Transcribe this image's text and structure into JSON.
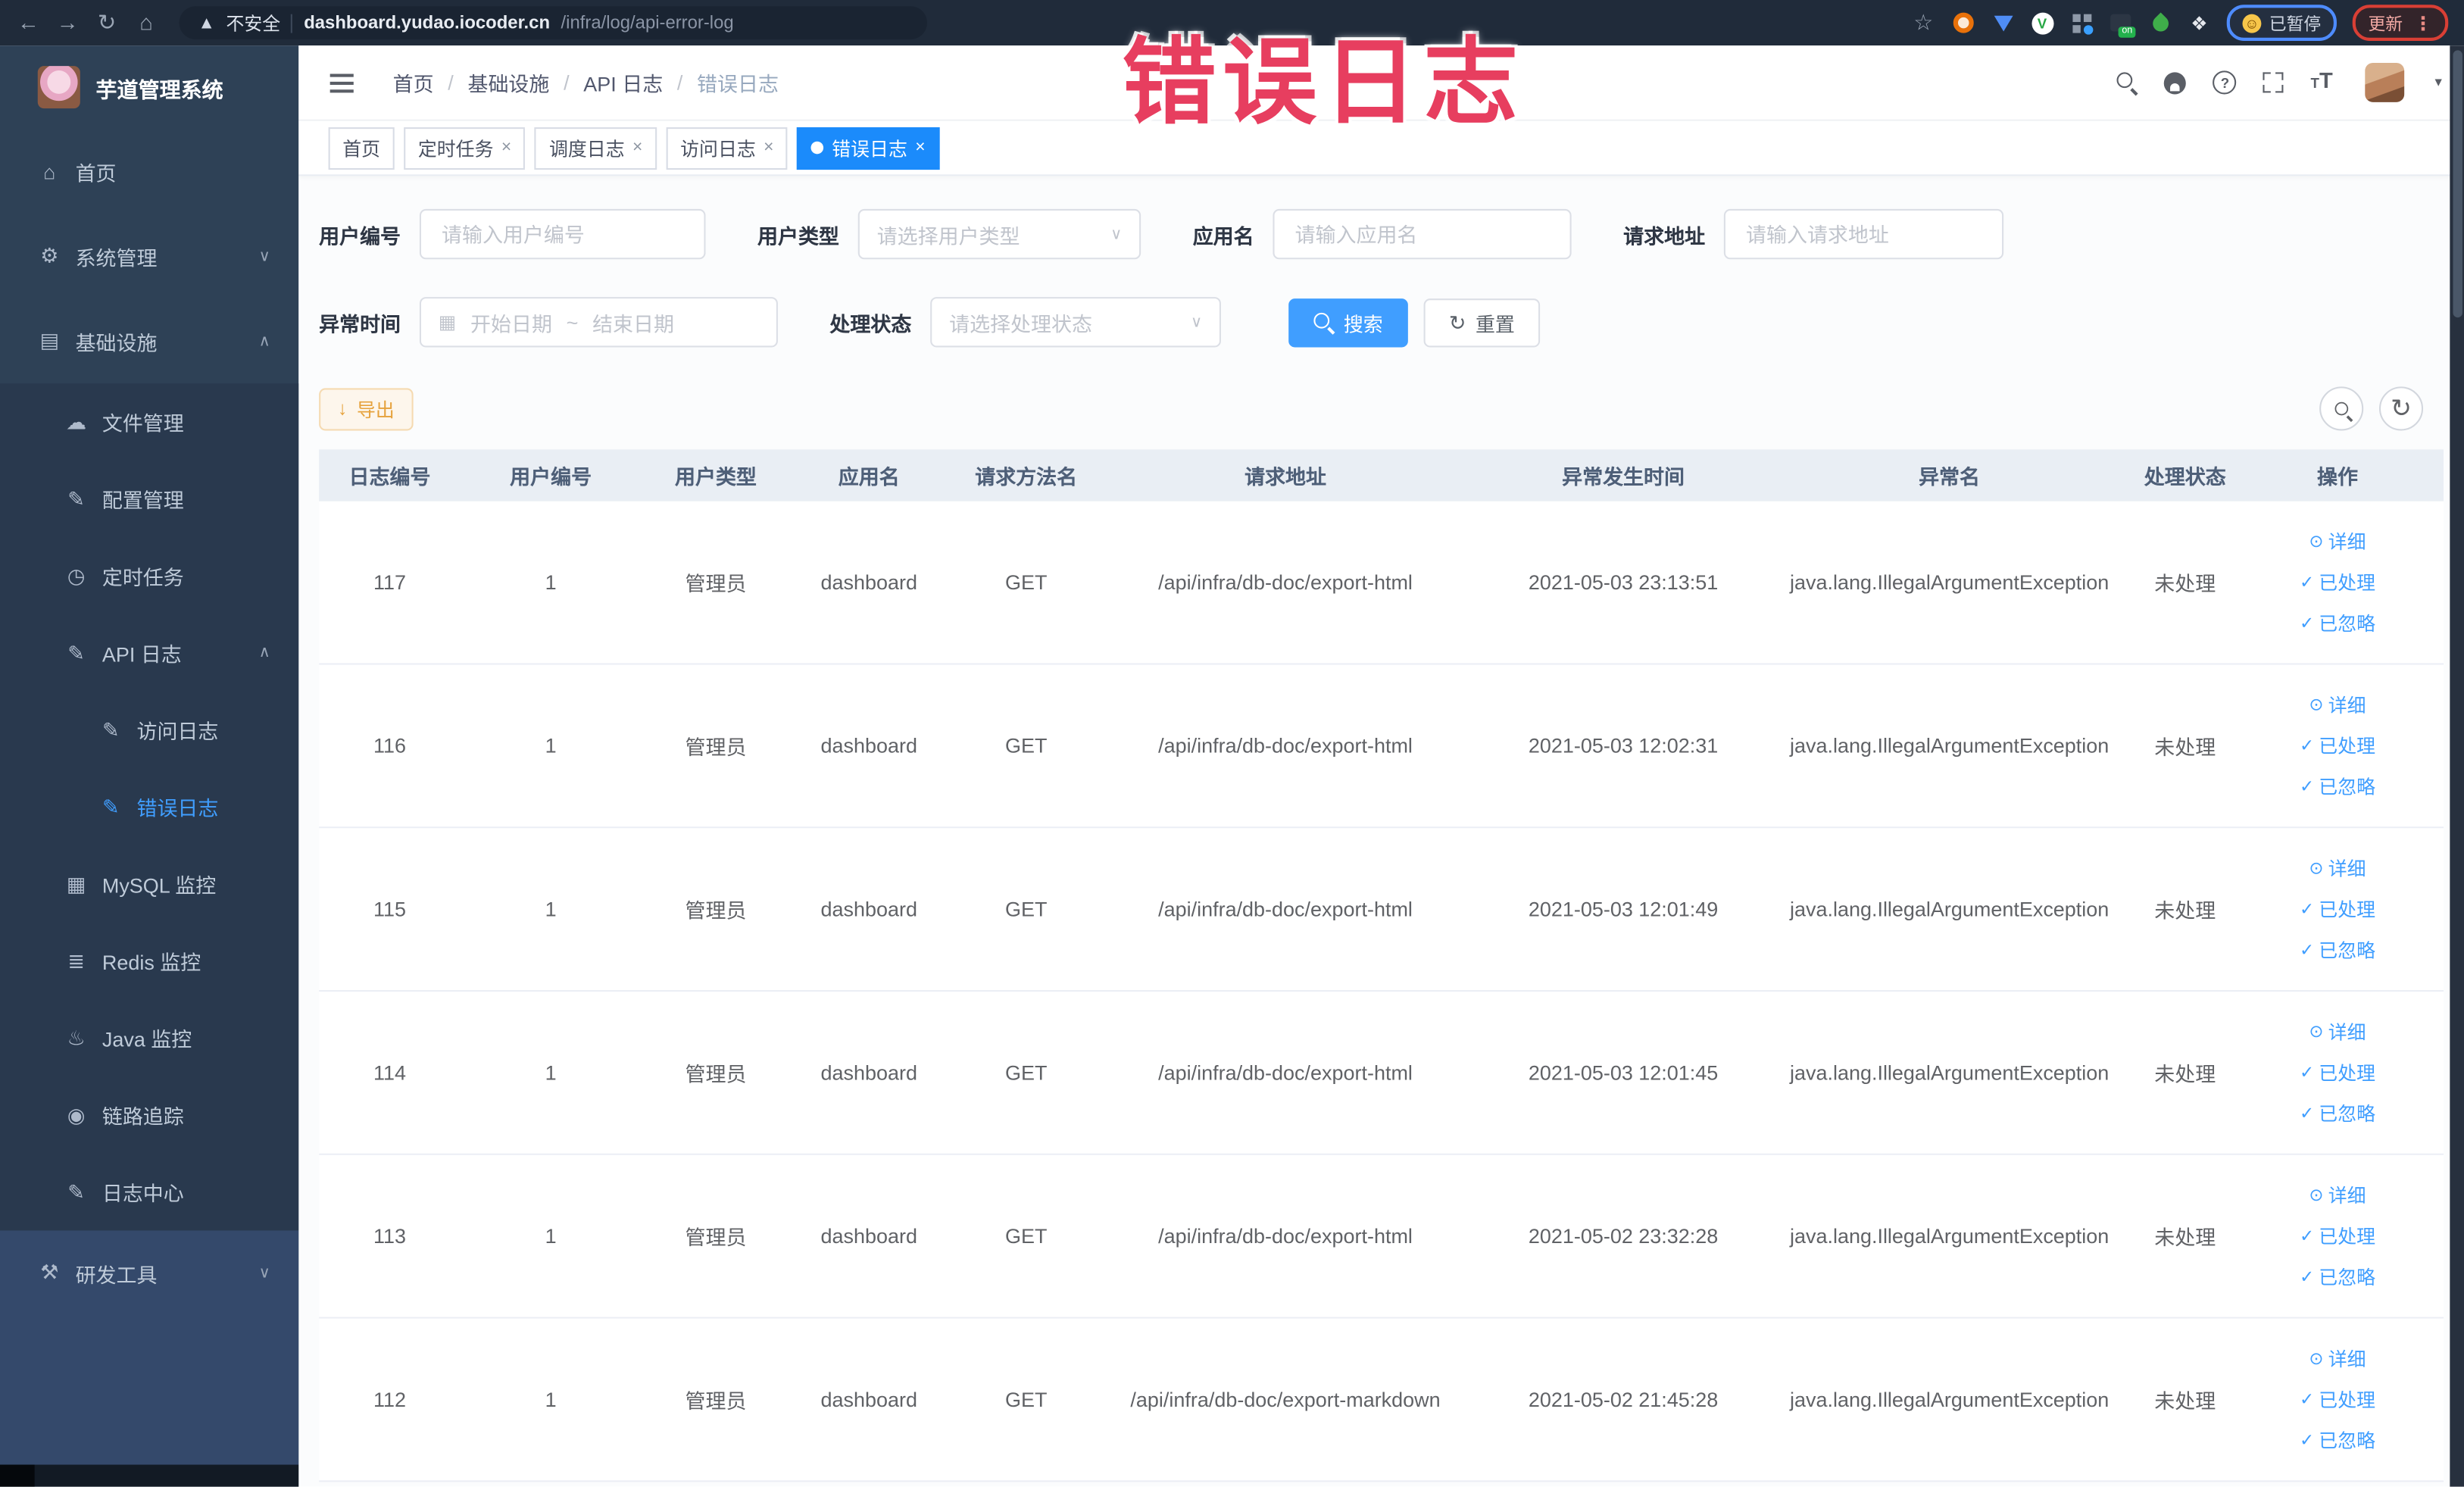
{
  "browser": {
    "security_label": "不安全",
    "url_domain": "dashboard.yudao.iocoder.cn",
    "url_path": "/infra/log/api-error-log",
    "paused_label": "已暂停",
    "update_label": "更新"
  },
  "watermark": "错误日志",
  "colors": {
    "accent": "#409eff",
    "active_tab": "#1b8bfb",
    "warning": "#e6a23c",
    "watermark_red": "#e73e5f",
    "sidebar_bg": "#2e4156",
    "table_header_bg": "#e9eef4"
  },
  "sidebar": {
    "title": "芋道管理系统",
    "items": [
      {
        "label": "首页"
      },
      {
        "label": "系统管理"
      },
      {
        "label": "基础设施"
      },
      {
        "label": "文件管理"
      },
      {
        "label": "配置管理"
      },
      {
        "label": "定时任务"
      },
      {
        "label": "API 日志"
      },
      {
        "label": "访问日志"
      },
      {
        "label": "错误日志"
      },
      {
        "label": "MySQL 监控"
      },
      {
        "label": "Redis 监控"
      },
      {
        "label": "Java 监控"
      },
      {
        "label": "链路追踪"
      },
      {
        "label": "日志中心"
      },
      {
        "label": "研发工具"
      }
    ]
  },
  "header": {
    "breadcrumb": [
      "首页",
      "基础设施",
      "API 日志",
      "错误日志"
    ]
  },
  "tabs": [
    {
      "label": "首页"
    },
    {
      "label": "定时任务"
    },
    {
      "label": "调度日志"
    },
    {
      "label": "访问日志"
    },
    {
      "label": "错误日志"
    }
  ],
  "filters": {
    "user_id_label": "用户编号",
    "user_id_placeholder": "请输入用户编号",
    "user_type_label": "用户类型",
    "user_type_placeholder": "请选择用户类型",
    "app_name_label": "应用名",
    "app_name_placeholder": "请输入应用名",
    "request_url_label": "请求地址",
    "request_url_placeholder": "请输入请求地址",
    "exception_time_label": "异常时间",
    "date_start_placeholder": "开始日期",
    "date_separator": "~",
    "date_end_placeholder": "结束日期",
    "process_status_label": "处理状态",
    "process_status_placeholder": "请选择处理状态",
    "search_button": "搜索",
    "reset_button": "重置"
  },
  "toolbar": {
    "export_button": "导出"
  },
  "table": {
    "columns": [
      "日志编号",
      "用户编号",
      "用户类型",
      "应用名",
      "请求方法名",
      "请求地址",
      "异常发生时间",
      "异常名",
      "处理状态",
      "操作"
    ],
    "action_labels": {
      "detail": "详细",
      "processed": "已处理",
      "ignored": "已忽略"
    },
    "rows": [
      {
        "id": "117",
        "user_id": "1",
        "user_type": "管理员",
        "app": "dashboard",
        "method": "GET",
        "url": "/api/infra/db-doc/export-html",
        "time": "2021-05-03 23:13:51",
        "exception": "java.lang.IllegalArgumentException",
        "status": "未处理"
      },
      {
        "id": "116",
        "user_id": "1",
        "user_type": "管理员",
        "app": "dashboard",
        "method": "GET",
        "url": "/api/infra/db-doc/export-html",
        "time": "2021-05-03 12:02:31",
        "exception": "java.lang.IllegalArgumentException",
        "status": "未处理"
      },
      {
        "id": "115",
        "user_id": "1",
        "user_type": "管理员",
        "app": "dashboard",
        "method": "GET",
        "url": "/api/infra/db-doc/export-html",
        "time": "2021-05-03 12:01:49",
        "exception": "java.lang.IllegalArgumentException",
        "status": "未处理"
      },
      {
        "id": "114",
        "user_id": "1",
        "user_type": "管理员",
        "app": "dashboard",
        "method": "GET",
        "url": "/api/infra/db-doc/export-html",
        "time": "2021-05-03 12:01:45",
        "exception": "java.lang.IllegalArgumentException",
        "status": "未处理"
      },
      {
        "id": "113",
        "user_id": "1",
        "user_type": "管理员",
        "app": "dashboard",
        "method": "GET",
        "url": "/api/infra/db-doc/export-html",
        "time": "2021-05-02 23:32:28",
        "exception": "java.lang.IllegalArgumentException",
        "status": "未处理"
      },
      {
        "id": "112",
        "user_id": "1",
        "user_type": "管理员",
        "app": "dashboard",
        "method": "GET",
        "url": "/api/infra/db-doc/export-markdown",
        "time": "2021-05-02 21:45:28",
        "exception": "java.lang.IllegalArgumentException",
        "status": "未处理"
      }
    ]
  }
}
